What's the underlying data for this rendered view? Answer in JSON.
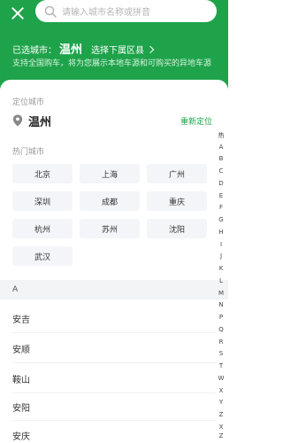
{
  "header": {
    "search_placeholder": "请输入城市名称或拼音",
    "selected_prefix": "已选城市：",
    "selected_city": "温州",
    "district_link": "选择下属区县",
    "support_text": "支持全国购车，将为您展示本地车源和可购买的异地车源",
    "accent": "#1ea34a"
  },
  "location": {
    "title": "定位城市",
    "city": "温州",
    "relocate": "重新定位"
  },
  "hot": {
    "title": "热门城市",
    "cities": [
      "北京",
      "上海",
      "广州",
      "深圳",
      "成都",
      "重庆",
      "杭州",
      "苏州",
      "沈阳",
      "武汉"
    ]
  },
  "list": {
    "group_letter": "A",
    "cities": [
      "安吉",
      "安顺",
      "鞍山",
      "安阳",
      "安庆"
    ]
  },
  "index": [
    "热",
    "A",
    "B",
    "C",
    "D",
    "E",
    "F",
    "G",
    "H",
    "I",
    "J",
    "K",
    "L",
    "M",
    "N",
    "P",
    "Q",
    "R",
    "S",
    "T",
    "W",
    "X",
    "Y",
    "Z",
    "X",
    "Z"
  ]
}
